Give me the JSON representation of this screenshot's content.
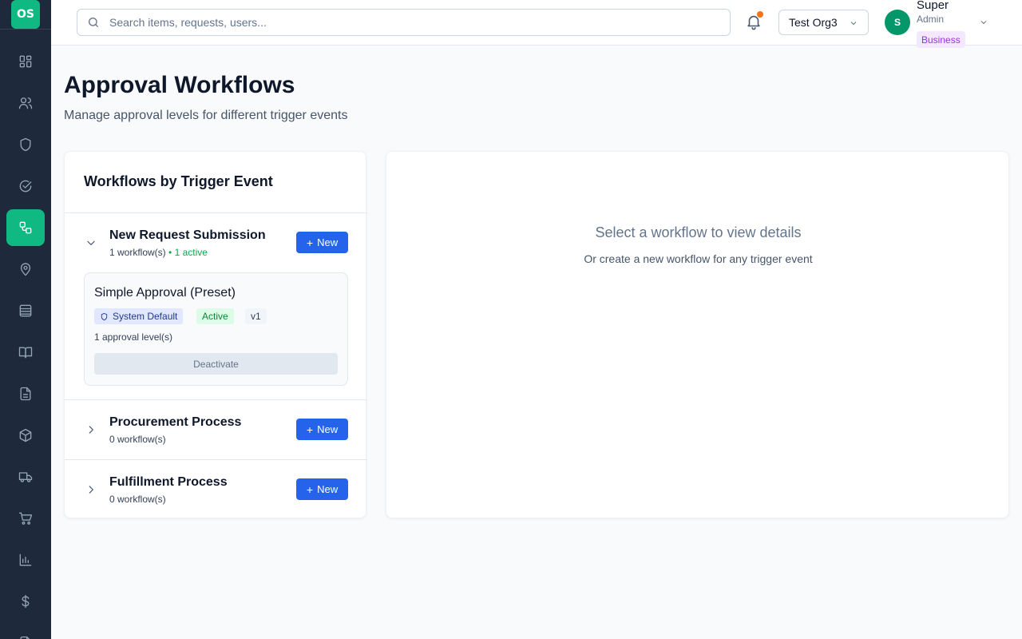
{
  "app": {
    "logo": "OS",
    "accent": "#10b981",
    "sidebar_bg": "#1e293b",
    "primary": "#2563eb"
  },
  "sidebar": {
    "items": [
      {
        "icon": "dashboard-icon",
        "active": false
      },
      {
        "icon": "users-icon",
        "active": false
      },
      {
        "icon": "shield-icon",
        "active": false
      },
      {
        "icon": "check-circle-icon",
        "active": false
      },
      {
        "icon": "workflow-icon",
        "active": true
      },
      {
        "icon": "location-pin-icon",
        "active": false
      },
      {
        "icon": "database-icon",
        "active": false
      },
      {
        "icon": "book-icon",
        "active": false
      },
      {
        "icon": "document-icon",
        "active": false
      },
      {
        "icon": "package-icon",
        "active": false
      },
      {
        "icon": "truck-icon",
        "active": false
      },
      {
        "icon": "cart-icon",
        "active": false
      },
      {
        "icon": "bar-chart-icon",
        "active": false
      },
      {
        "icon": "dollar-icon",
        "active": false
      }
    ]
  },
  "header": {
    "search_placeholder": "Search items, requests, users...",
    "org": "Test Org3",
    "user": {
      "initial": "S",
      "name": "Super",
      "role": "Admin",
      "plan": "Business"
    }
  },
  "page": {
    "title": "Approval Workflows",
    "subtitle": "Manage approval levels for different trigger events"
  },
  "left_panel": {
    "title": "Workflows by Trigger Event",
    "new_label": "New",
    "groups": [
      {
        "name": "New Request Submission",
        "count": "1 workflow(s)",
        "active": "• 1 active",
        "expanded": true,
        "workflows": [
          {
            "name": "Simple Approval (Preset)",
            "badge_system": "System Default",
            "badge_status": "Active",
            "badge_version": "v1",
            "levels": "1 approval level(s)",
            "action": "Deactivate"
          }
        ]
      },
      {
        "name": "Procurement Process",
        "count": "0 workflow(s)",
        "expanded": false
      },
      {
        "name": "Fulfillment Process",
        "count": "0 workflow(s)",
        "expanded": false
      }
    ]
  },
  "right_panel": {
    "empty_title": "Select a workflow to view details",
    "empty_subtitle": "Or create a new workflow for any trigger event"
  }
}
